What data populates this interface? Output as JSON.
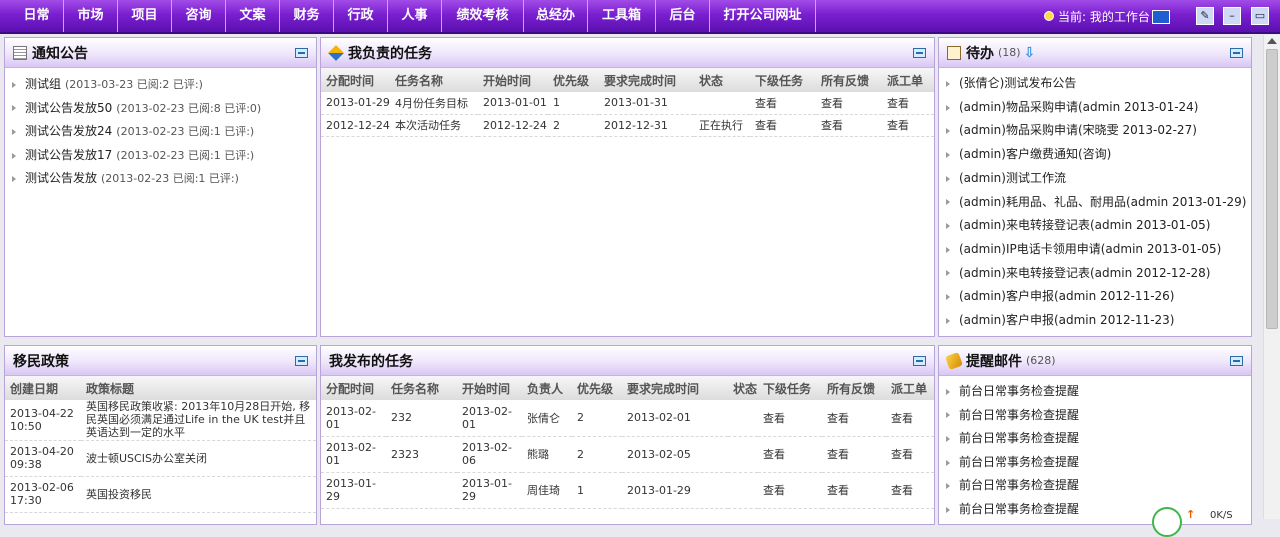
{
  "nav": {
    "items": [
      "日常",
      "市场",
      "项目",
      "咨询",
      "文案",
      "财务",
      "行政",
      "人事",
      "绩效考核",
      "总经办",
      "工具箱",
      "后台",
      "打开公司网址"
    ],
    "location_label": "当前: 我的工作台"
  },
  "toolbar": {
    "edit_icon": "pencil-icon",
    "minimize_icon": "minimize-icon",
    "maximize_icon": "maximize-icon"
  },
  "notice": {
    "title": "通知公告",
    "items": [
      {
        "title": "测试组",
        "meta": "(2013-03-23 已阅:2 已评:)"
      },
      {
        "title": "测试公告发放50",
        "meta": "(2013-02-23 已阅:8 已评:0)"
      },
      {
        "title": "测试公告发放24",
        "meta": "(2013-02-23 已阅:1 已评:)"
      },
      {
        "title": "测试公告发放17",
        "meta": "(2013-02-23 已阅:1 已评:)"
      },
      {
        "title": "测试公告发放",
        "meta": "(2013-02-23 已阅:1 已评:)"
      }
    ]
  },
  "my_tasks": {
    "title": "我负责的任务",
    "headers": [
      "分配时间",
      "任务名称",
      "开始时间",
      "优先级",
      "要求完成时间",
      "状态",
      "下级任务",
      "所有反馈",
      "派工单"
    ],
    "rows": [
      [
        "2013-01-29",
        "4月份任务目标",
        "2013-01-01",
        "1",
        "2013-01-31",
        "",
        "查看",
        "查看",
        "查看"
      ],
      [
        "2012-12-24",
        "本次活动任务",
        "2012-12-24",
        "2",
        "2012-12-31",
        "正在执行",
        "查看",
        "查看",
        "查看"
      ]
    ]
  },
  "todo": {
    "title": "待办",
    "count": "(18)",
    "items": [
      "(张倩仑)测试发布公告",
      "(admin)物品采购申请(admin 2013-01-24)",
      "(admin)物品采购申请(宋晓雯 2013-02-27)",
      "(admin)客户缴费通知(咨询)",
      "(admin)测试工作流",
      "(admin)耗用品、礼品、耐用品(admin 2013-01-29)",
      "(admin)来电转接登记表(admin 2013-01-05)",
      "(admin)IP电话卡领用申请(admin 2013-01-05)",
      "(admin)来电转接登记表(admin 2012-12-28)",
      "(admin)客户申报(admin 2012-11-26)",
      "(admin)客户申报(admin 2012-11-23)"
    ]
  },
  "immigration": {
    "title": "移民政策",
    "headers": [
      "创建日期",
      "政策标题"
    ],
    "rows": [
      [
        "2013-04-22 10:50",
        "英国移民政策收紧: 2013年10月28日开始, 移民英国必须满足通过Life in the UK test并且英语达到一定的水平"
      ],
      [
        "2013-04-20 09:38",
        "波士顿USCIS办公室关闭"
      ],
      [
        "2013-02-06 17:30",
        "英国投资移民"
      ]
    ]
  },
  "published_tasks": {
    "title": "我发布的任务",
    "headers": [
      "分配时间",
      "任务名称",
      "开始时间",
      "负责人",
      "优先级",
      "要求完成时间",
      "状态",
      "下级任务",
      "所有反馈",
      "派工单"
    ],
    "rows": [
      [
        "2013-02-01",
        "232",
        "2013-02-01",
        "张倩仑",
        "2",
        "2013-02-01",
        "",
        "查看",
        "查看",
        "查看"
      ],
      [
        "2013-02-01",
        "2323",
        "2013-02-06",
        "熊璐",
        "2",
        "2013-02-05",
        "",
        "查看",
        "查看",
        "查看"
      ],
      [
        "2013-01-29",
        "",
        "2013-01-29",
        "周佳琦",
        "1",
        "2013-01-29",
        "",
        "查看",
        "查看",
        "查看"
      ]
    ]
  },
  "reminder": {
    "title": "提醒邮件",
    "count": "(628)",
    "items": [
      "前台日常事务检查提醒",
      "前台日常事务检查提醒",
      "前台日常事务检查提醒",
      "前台日常事务检查提醒",
      "前台日常事务检查提醒",
      "前台日常事务检查提醒"
    ]
  },
  "speed": {
    "label": "0K/S"
  },
  "colors": {
    "nav": "#7a1fd0",
    "panel_header": "#e4d6f8",
    "panel_border": "#b7a4d8"
  }
}
